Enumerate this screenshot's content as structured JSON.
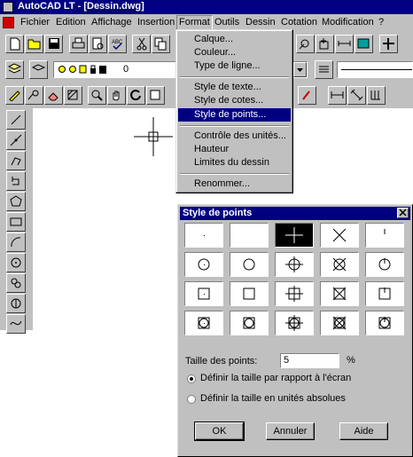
{
  "window": {
    "title": "AutoCAD LT - [Dessin.dwg]"
  },
  "menubar": {
    "items": [
      {
        "label": "Fichier"
      },
      {
        "label": "Edition"
      },
      {
        "label": "Affichage"
      },
      {
        "label": "Insertion"
      },
      {
        "label": "Format"
      },
      {
        "label": "Outils"
      },
      {
        "label": "Dessin"
      },
      {
        "label": "Cotation"
      },
      {
        "label": "Modification"
      },
      {
        "label": "?"
      }
    ]
  },
  "layer_bar": {
    "current_layer": "0"
  },
  "format_menu": {
    "items": [
      {
        "label": "Calque..."
      },
      {
        "label": "Couleur..."
      },
      {
        "label": "Type de ligne..."
      },
      {
        "label": "Style de texte..."
      },
      {
        "label": "Style de cotes..."
      },
      {
        "label": "Style de points..."
      },
      {
        "label": "Contrôle des unités..."
      },
      {
        "label": "Hauteur"
      },
      {
        "label": "Limites du dessin"
      },
      {
        "label": "Renommer..."
      }
    ],
    "highlighted": "Style de points..."
  },
  "dialog": {
    "title": "Style de points",
    "selected_style_index": 2,
    "size_label": "Taille des points:",
    "size_value": "5",
    "size_unit": "%",
    "radio_relative": "Définir la taille par rapport à l'écran",
    "radio_absolute": "Définir la taille en unités absolues",
    "radio_selected": "relative",
    "ok_label": "OK",
    "cancel_label": "Annuler",
    "help_label": "Aide"
  },
  "colors": {
    "titlebar": "#000080",
    "face": "#c0c0c0",
    "highlight": "#000080"
  }
}
